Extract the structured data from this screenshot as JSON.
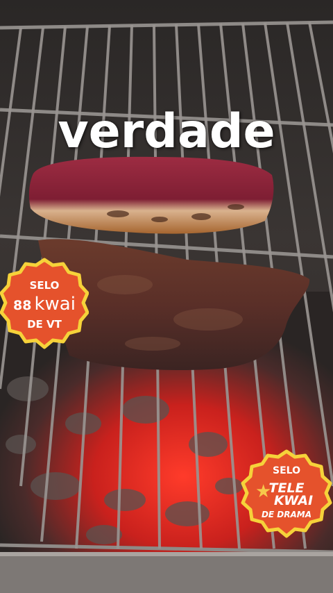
{
  "caption": "verdade",
  "badges": {
    "vt": {
      "line1": "SELO",
      "brand_symbol": "88",
      "brand": "kwai",
      "line3": "DE VT"
    },
    "drama": {
      "line1": "SELO",
      "star_icon": "★",
      "line2a": "TELE",
      "line2b": "KWAI",
      "line3": "DE DRAMA"
    }
  },
  "colors": {
    "badge_fill": "#e5522c",
    "badge_border": "#f6d23a"
  }
}
